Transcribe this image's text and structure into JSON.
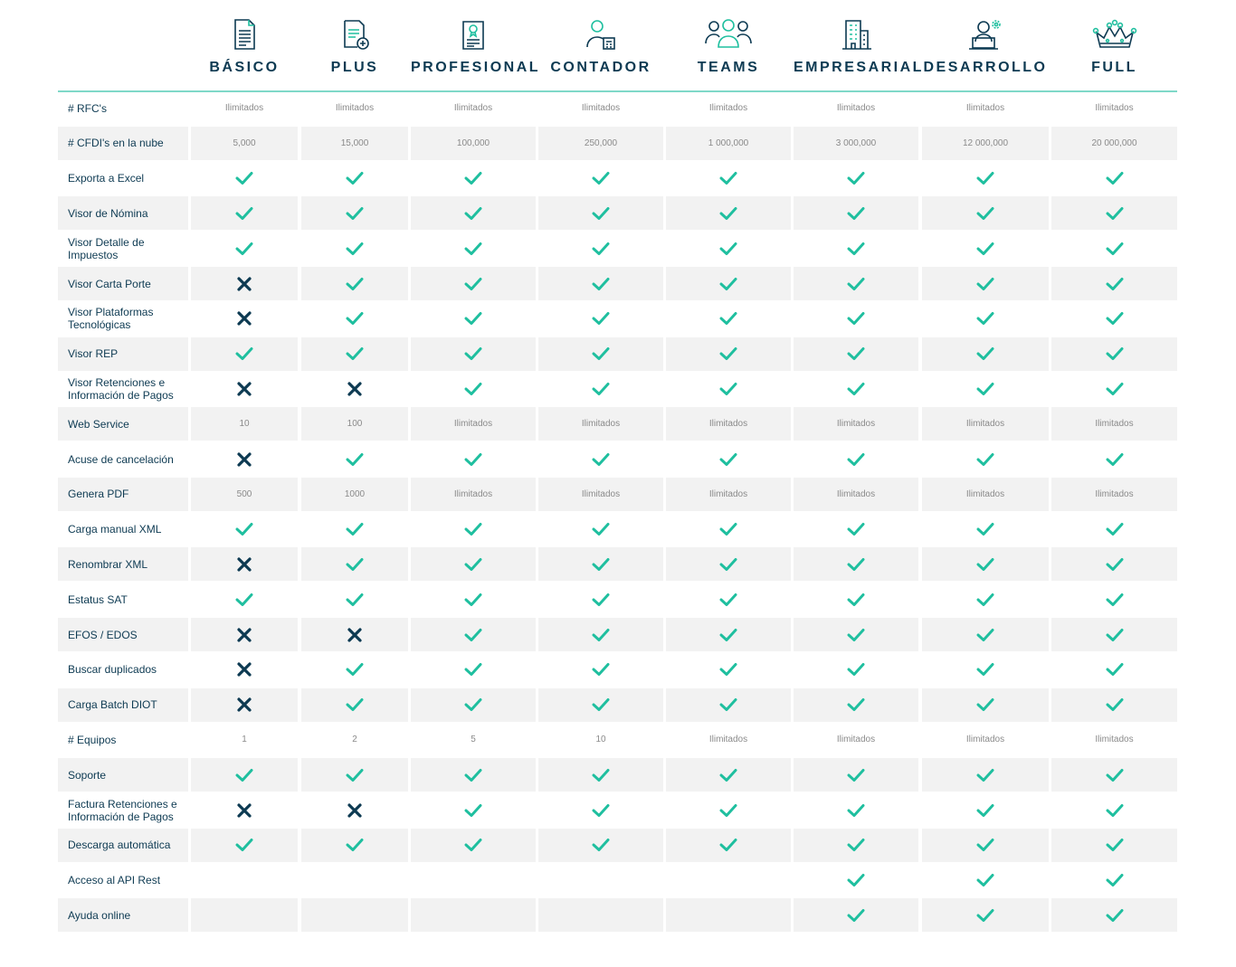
{
  "plans": [
    {
      "name": "BÁSICO",
      "icon": "document-list-icon"
    },
    {
      "name": "PLUS",
      "icon": "document-add-icon"
    },
    {
      "name": "PROFESIONAL",
      "icon": "certificate-document-icon"
    },
    {
      "name": "CONTADOR",
      "icon": "accountant-calculator-icon"
    },
    {
      "name": "TEAMS",
      "icon": "team-users-icon"
    },
    {
      "name": "EMPRESARIAL",
      "icon": "office-building-icon"
    },
    {
      "name": "DESARROLLO",
      "icon": "developer-laptop-icon"
    },
    {
      "name": "FULL",
      "icon": "crown-icon"
    }
  ],
  "colors": {
    "accent": "#1fbf9f",
    "header_text": "#0d3a52",
    "cross": "#0d3a52",
    "row_shade": "#f2f2f2",
    "divider": "#7fd8c8"
  },
  "rows": [
    {
      "label": "# RFC's",
      "values": [
        "Ilimitados",
        "Ilimitados",
        "Ilimitados",
        "Ilimitados",
        "Ilimitados",
        "Ilimitados",
        "Ilimitados",
        "Ilimitados"
      ]
    },
    {
      "label": "# CFDI's en la nube",
      "values": [
        "5,000",
        "15,000",
        "100,000",
        "250,000",
        "1 000,000",
        "3 000,000",
        "12 000,000",
        "20 000,000"
      ]
    },
    {
      "label": "Exporta a Excel",
      "values": [
        "check",
        "check",
        "check",
        "check",
        "check",
        "check",
        "check",
        "check"
      ]
    },
    {
      "label": "Visor de Nómina",
      "values": [
        "check",
        "check",
        "check",
        "check",
        "check",
        "check",
        "check",
        "check"
      ]
    },
    {
      "label": "Visor Detalle de Impuestos",
      "values": [
        "check",
        "check",
        "check",
        "check",
        "check",
        "check",
        "check",
        "check"
      ]
    },
    {
      "label": "Visor Carta Porte",
      "values": [
        "cross",
        "check",
        "check",
        "check",
        "check",
        "check",
        "check",
        "check"
      ]
    },
    {
      "label": "Visor Plataformas Tecnológicas",
      "values": [
        "cross",
        "check",
        "check",
        "check",
        "check",
        "check",
        "check",
        "check"
      ]
    },
    {
      "label": "Visor REP",
      "values": [
        "check",
        "check",
        "check",
        "check",
        "check",
        "check",
        "check",
        "check"
      ]
    },
    {
      "label": "Visor Retenciones e Información de Pagos",
      "values": [
        "cross",
        "cross",
        "check",
        "check",
        "check",
        "check",
        "check",
        "check"
      ]
    },
    {
      "label": "Web Service",
      "values": [
        "10",
        "100",
        "Ilimitados",
        "Ilimitados",
        "Ilimitados",
        "Ilimitados",
        "Ilimitados",
        "Ilimitados"
      ]
    },
    {
      "label": "Acuse de cancelación",
      "values": [
        "cross",
        "check",
        "check",
        "check",
        "check",
        "check",
        "check",
        "check"
      ]
    },
    {
      "label": "Genera PDF",
      "values": [
        "500",
        "1000",
        "Ilimitados",
        "Ilimitados",
        "Ilimitados",
        "Ilimitados",
        "Ilimitados",
        "Ilimitados"
      ]
    },
    {
      "label": "Carga manual XML",
      "values": [
        "check",
        "check",
        "check",
        "check",
        "check",
        "check",
        "check",
        "check"
      ]
    },
    {
      "label": "Renombrar XML",
      "values": [
        "cross",
        "check",
        "check",
        "check",
        "check",
        "check",
        "check",
        "check"
      ]
    },
    {
      "label": "Estatus SAT",
      "values": [
        "check",
        "check",
        "check",
        "check",
        "check",
        "check",
        "check",
        "check"
      ]
    },
    {
      "label": "EFOS / EDOS",
      "values": [
        "cross",
        "cross",
        "check",
        "check",
        "check",
        "check",
        "check",
        "check"
      ]
    },
    {
      "label": "Buscar duplicados",
      "values": [
        "cross",
        "check",
        "check",
        "check",
        "check",
        "check",
        "check",
        "check"
      ]
    },
    {
      "label": "Carga Batch DIOT",
      "values": [
        "cross",
        "check",
        "check",
        "check",
        "check",
        "check",
        "check",
        "check"
      ]
    },
    {
      "label": "# Equipos",
      "values": [
        "1",
        "2",
        "5",
        "10",
        "Ilimitados",
        "Ilimitados",
        "Ilimitados",
        "Ilimitados"
      ]
    },
    {
      "label": "Soporte",
      "values": [
        "check",
        "check",
        "check",
        "check",
        "check",
        "check",
        "check",
        "check"
      ]
    },
    {
      "label": "Factura Retenciones e Información de Pagos",
      "values": [
        "cross",
        "cross",
        "check",
        "check",
        "check",
        "check",
        "check",
        "check"
      ]
    },
    {
      "label": "Descarga automática",
      "values": [
        "check",
        "check",
        "check",
        "check",
        "check",
        "check",
        "check",
        "check"
      ]
    },
    {
      "label": "Acceso al API Rest",
      "values": [
        "",
        "",
        "",
        "",
        "",
        "check",
        "check",
        "check"
      ]
    },
    {
      "label": "Ayuda online",
      "values": [
        "",
        "",
        "",
        "",
        "",
        "check",
        "check",
        "check"
      ]
    }
  ]
}
